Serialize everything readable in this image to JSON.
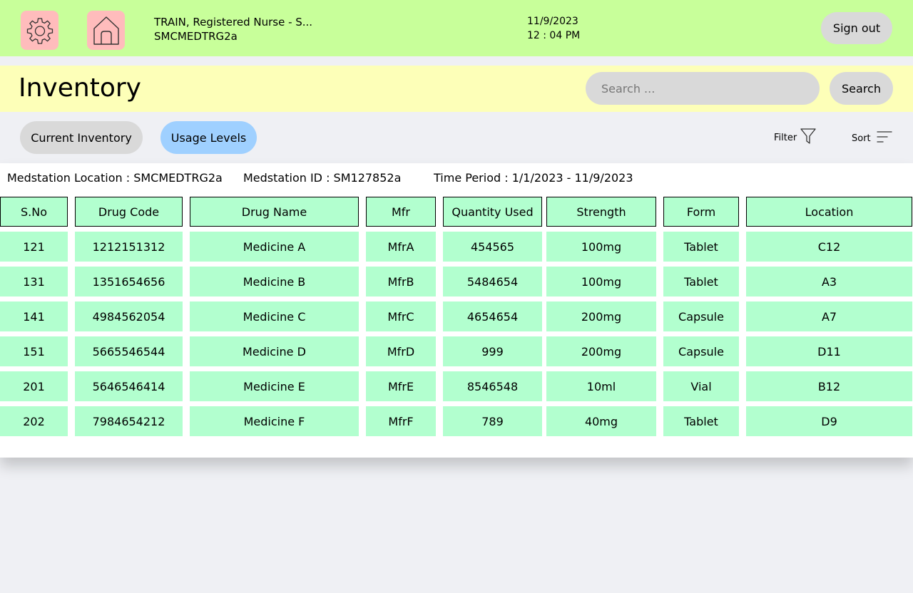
{
  "header": {
    "user_line1": "TRAIN, Registered Nurse - S...",
    "user_line2": "SMCMEDTRG2a",
    "date": "11/9/2023",
    "time": "12 : 04 PM",
    "signout_label": "Sign out",
    "settings_icon": "gear-icon",
    "home_icon": "home-icon"
  },
  "page": {
    "title": "Inventory",
    "search_placeholder": "Search ...",
    "search_value": "",
    "search_label": "Search"
  },
  "tabs": [
    {
      "label": "Current Inventory",
      "active": false
    },
    {
      "label": "Usage Levels",
      "active": true
    }
  ],
  "toolbar": {
    "filter_label": "Filter",
    "sort_label": "Sort"
  },
  "meta": {
    "location": "Medstation Location : SMCMEDTRG2a",
    "medstation_id": "Medstation ID : SM127852a",
    "time_period": "Time Period :  1/1/2023 - 11/9/2023"
  },
  "table": {
    "columns": [
      "S.No",
      "Drug Code",
      "Drug Name",
      "Mfr",
      "Quantity Used",
      "Strength",
      "Form",
      "Location"
    ],
    "rows": [
      [
        "121",
        "1212151312",
        "Medicine A",
        "MfrA",
        "454565",
        "100mg",
        "Tablet",
        "C12"
      ],
      [
        "131",
        "1351654656",
        "Medicine B",
        "MfrB",
        "5484654",
        "100mg",
        "Tablet",
        "A3"
      ],
      [
        "141",
        "4984562054",
        "Medicine C",
        "MfrC",
        "4654654",
        "200mg",
        "Capsule",
        "A7"
      ],
      [
        "151",
        "5665546544",
        "Medicine D",
        "MfrD",
        "999",
        "200mg",
        "Capsule",
        "D11"
      ],
      [
        "201",
        "5646546414",
        "Medicine E",
        "MfrE",
        "8546548",
        "10ml",
        "Vial",
        "B12"
      ],
      [
        "202",
        "7984654212",
        "Medicine F",
        "MfrF",
        "789",
        "40mg",
        "Tablet",
        "D9"
      ]
    ]
  },
  "colors": {
    "topbar": "#c8ff9a",
    "titlebar": "#fdffb8",
    "icon_button": "#ffbcbc",
    "active_tab": "#9fd0ff",
    "cell": "#b2ffcf"
  }
}
